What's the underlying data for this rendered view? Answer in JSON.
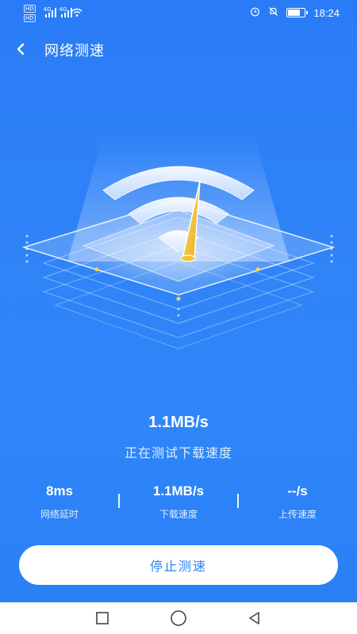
{
  "status_bar": {
    "left_tags": [
      "HD",
      "HD"
    ],
    "network_labels": [
      "4G",
      "4G"
    ],
    "time": "18:24",
    "battery_level": 0.8
  },
  "header": {
    "title": "网络测速"
  },
  "speed": {
    "current": "1.1MB/s",
    "status": "正在测试下载速度"
  },
  "stats": [
    {
      "value": "8ms",
      "label": "网络延时"
    },
    {
      "value": "1.1MB/s",
      "label": "下载速度"
    },
    {
      "value": "--/s",
      "label": "上传速度"
    }
  ],
  "actions": {
    "stop_label": "停止测速"
  },
  "colors": {
    "primary": "#2a7ff5",
    "needle": "#f5c531",
    "white": "#ffffff"
  },
  "icons": {
    "back": "chevron-left-icon",
    "wifi": "wifi-icon",
    "alarm": "alarm-icon",
    "mute": "bell-off-icon",
    "battery": "battery-icon",
    "nav_square": "square-icon",
    "nav_circle": "circle-icon",
    "nav_back": "triangle-back-icon"
  }
}
